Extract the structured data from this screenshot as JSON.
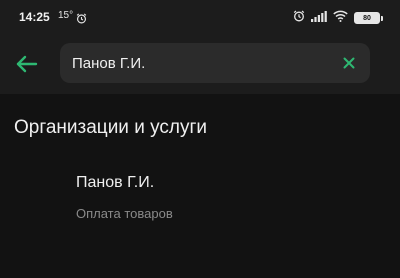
{
  "status_bar": {
    "time": "14:25",
    "temperature": "15°",
    "battery": "80",
    "icons": [
      "alarm-icon",
      "signal-icon",
      "wifi-icon",
      "battery-icon"
    ]
  },
  "search": {
    "query": "Панов Г.И.",
    "back_icon": "arrow-left-icon",
    "clear_icon": "close-icon"
  },
  "section": {
    "title": "Организации и услуги"
  },
  "results": [
    {
      "name": "Панов Г.И.",
      "subtitle": "Оплата товаров"
    }
  ],
  "colors": {
    "accent": "#2eb872",
    "background": "#121212",
    "bar": "#1c1c1c",
    "search_field": "#2b2b2b"
  }
}
